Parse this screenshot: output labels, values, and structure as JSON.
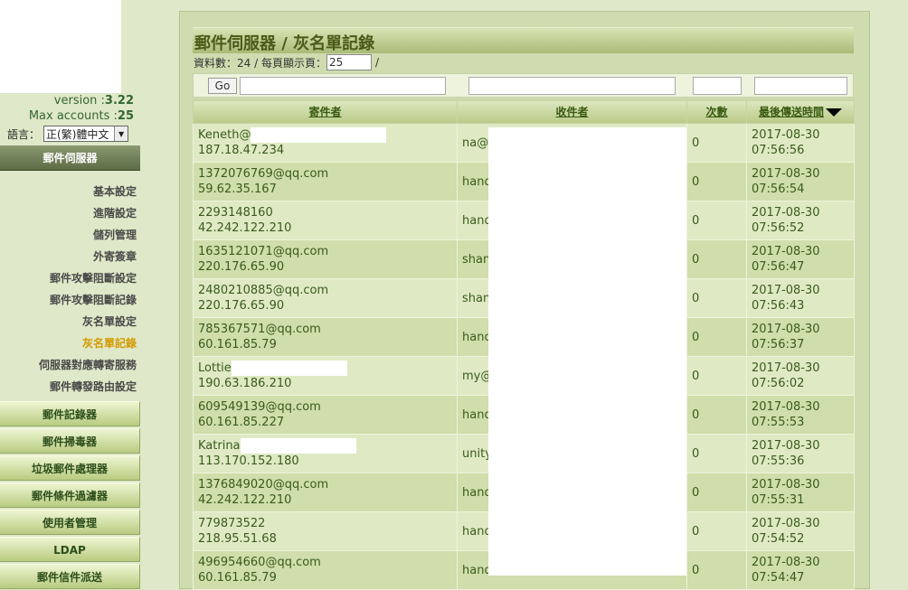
{
  "sidebar": {
    "version_label": "version :",
    "version_value": "3.22",
    "max_label": "Max accounts :",
    "max_value": "25",
    "lang_label": "語言：",
    "lang_value": "正(繁)體中文",
    "active_section": "郵件伺服器",
    "sub_items": [
      "基本設定",
      "進階設定",
      "儲列管理",
      "外寄簽章",
      "郵件攻擊阻斷設定",
      "郵件攻擊阻斷記錄",
      "灰名單設定",
      "灰名單記錄",
      "伺服器對應轉寄服務",
      "郵件轉發路由設定"
    ],
    "current_item": "灰名單記錄",
    "sections": [
      "郵件記錄器",
      "郵件掃毒器",
      "垃圾郵件處理器",
      "郵件條件過濾器",
      "使用者管理",
      "LDAP",
      "郵件信件派送"
    ]
  },
  "page": {
    "title": "郵件伺服器 / 灰名單記錄",
    "count_label": "資料數：24 / 每頁顯示頁：",
    "per_page": "25",
    "slash": "/",
    "go_label": "Go"
  },
  "table": {
    "headers": [
      "寄件者",
      "收件者",
      "次數",
      "最後傳送時間"
    ],
    "rows": [
      {
        "sender": "Keneth@",
        "ip": "187.18.47.234",
        "recipient": "na@l",
        "count": "0",
        "date": "2017-08-30",
        "time": "07:56:56",
        "mask": 150
      },
      {
        "sender": "1372076769@qq.com",
        "ip": "59.62.35.167",
        "recipient": "hand",
        "count": "0",
        "date": "2017-08-30",
        "time": "07:56:54",
        "mask": 0
      },
      {
        "sender": "2293148160",
        "ip": "42.242.122.210",
        "recipient": "hand",
        "count": "0",
        "date": "2017-08-30",
        "time": "07:56:52",
        "mask": 0
      },
      {
        "sender": "1635121071@qq.com",
        "ip": "220.176.65.90",
        "recipient": "shan",
        "count": "0",
        "date": "2017-08-30",
        "time": "07:56:47",
        "mask": 0
      },
      {
        "sender": "2480210885@qq.com",
        "ip": "220.176.65.90",
        "recipient": "shan",
        "count": "0",
        "date": "2017-08-30",
        "time": "07:56:43",
        "mask": 0
      },
      {
        "sender": "785367571@qq.com",
        "ip": "60.161.85.79",
        "recipient": "hand",
        "count": "0",
        "date": "2017-08-30",
        "time": "07:56:37",
        "mask": 0
      },
      {
        "sender": "Lottie",
        "ip": "190.63.186.210",
        "recipient": "my@",
        "count": "0",
        "date": "2017-08-30",
        "time": "07:56:02",
        "mask": 128
      },
      {
        "sender": "609549139@qq.com",
        "ip": "60.161.85.227",
        "recipient": "hand",
        "count": "0",
        "date": "2017-08-30",
        "time": "07:55:53",
        "mask": 0
      },
      {
        "sender": "Katrina",
        "ip": "113.170.152.180",
        "recipient": "unity",
        "count": "0",
        "date": "2017-08-30",
        "time": "07:55:36",
        "mask": 128
      },
      {
        "sender": "1376849020@qq.com",
        "ip": "42.242.122.210",
        "recipient": "hand",
        "count": "0",
        "date": "2017-08-30",
        "time": "07:55:31",
        "mask": 0
      },
      {
        "sender": "779873522",
        "ip": "218.95.51.68",
        "recipient": "hand",
        "count": "0",
        "date": "2017-08-30",
        "time": "07:54:52",
        "mask": 0
      },
      {
        "sender": "496954660@qq.com",
        "ip": "60.161.85.79",
        "recipient": "hand",
        "count": "0",
        "date": "2017-08-30",
        "time": "07:54:47",
        "mask": 0
      }
    ]
  }
}
